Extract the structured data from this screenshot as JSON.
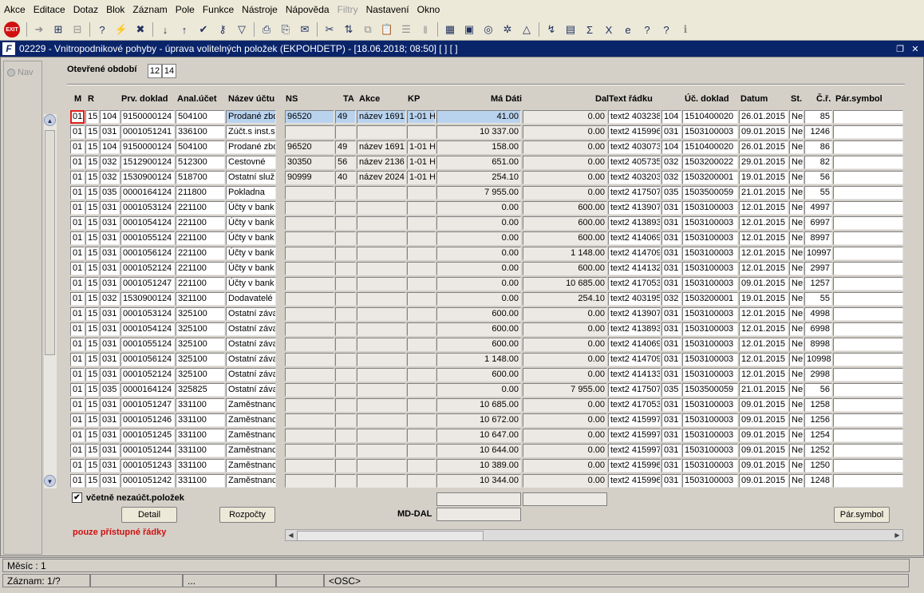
{
  "menu": [
    "Akce",
    "Editace",
    "Dotaz",
    "Blok",
    "Záznam",
    "Pole",
    "Funkce",
    "Nástroje",
    "Nápověda",
    "Filtry",
    "Nastavení",
    "Okno"
  ],
  "disabled_menu": "Filtry",
  "toolbar_icons": [
    "exit-icon",
    "sep",
    "arrow-icon",
    "insert-record-icon",
    "delete-record-icon",
    "sep",
    "query-icon",
    "query-run-icon",
    "cancel-query-icon",
    "sep",
    "sort-asc-icon",
    "sort-desc-icon",
    "check-icon",
    "key-icon",
    "filter-icon",
    "sep",
    "print-icon",
    "print-preview-icon",
    "mail-icon",
    "sep",
    "tools-icon",
    "split-icon",
    "copy-icon",
    "paste-icon",
    "list-icon",
    "columns-icon",
    "sep",
    "calc-icon",
    "save-icon",
    "globe-icon",
    "settings-icon",
    "triangle-icon",
    "sep",
    "chart-icon",
    "image-icon",
    "sum-icon",
    "excel-icon",
    "ie-icon",
    "help-context-icon",
    "help-icon",
    "info-icon"
  ],
  "window": {
    "title": "02229 - Vnitropodnikové pohyby - úprava volitelných položek (EKPOHDETP) - [18.06.2018; 08:50]  [ ]  [ ]"
  },
  "nav": {
    "label": "Nav"
  },
  "period": {
    "label": "Otevřené období",
    "from": "12",
    "to": "14"
  },
  "columns": [
    "M",
    "R",
    "",
    "Prv. doklad",
    "Anal.účet",
    "Název účtu",
    "NS",
    "TA",
    "Akce",
    "KP",
    "Má Dáti",
    "Dal",
    "Text řádku",
    "",
    "Úč. doklad",
    "Datum",
    "St.",
    "Č.ř.",
    "Pár.symbol"
  ],
  "rows": [
    [
      "01",
      "15",
      "104",
      "9150000124",
      "504100",
      "Prodané zbo",
      "96520",
      "49",
      "název 1691",
      "1-01 H",
      "41.00",
      "0.00",
      "text2 403238",
      "104",
      "1510400020",
      "26.01.2015",
      "Ne",
      "85",
      ""
    ],
    [
      "01",
      "15",
      "031",
      "0001051241",
      "336100",
      "Zúčt.s inst.s",
      "",
      "",
      "",
      "",
      "10 337.00",
      "0.00",
      "text2 415996",
      "031",
      "1503100003",
      "09.01.2015",
      "Ne",
      "1246",
      ""
    ],
    [
      "01",
      "15",
      "104",
      "9150000124",
      "504100",
      "Prodané zbo",
      "96520",
      "49",
      "název 1691",
      "1-01 H",
      "158.00",
      "0.00",
      "text2 403073",
      "104",
      "1510400020",
      "26.01.2015",
      "Ne",
      "86",
      ""
    ],
    [
      "01",
      "15",
      "032",
      "1512900124",
      "512300",
      "Cestovné",
      "30350",
      "56",
      "název 2136",
      "1-01 H",
      "651.00",
      "0.00",
      "text2 405735",
      "032",
      "1503200022",
      "29.01.2015",
      "Ne",
      "82",
      ""
    ],
    [
      "01",
      "15",
      "032",
      "1530900124",
      "518700",
      "Ostatní služ",
      "90999",
      "40",
      "název 2024",
      "1-01 H",
      "254.10",
      "0.00",
      "text2 403203",
      "032",
      "1503200001",
      "19.01.2015",
      "Ne",
      "56",
      ""
    ],
    [
      "01",
      "15",
      "035",
      "0000164124",
      "211800",
      "Pokladna",
      "",
      "",
      "",
      "",
      "7 955.00",
      "0.00",
      "text2 417507",
      "035",
      "1503500059",
      "21.01.2015",
      "Ne",
      "55",
      ""
    ],
    [
      "01",
      "15",
      "031",
      "0001053124",
      "221100",
      "Účty v bank",
      "",
      "",
      "",
      "",
      "0.00",
      "600.00",
      "text2 413907",
      "031",
      "1503100003",
      "12.01.2015",
      "Ne",
      "4997",
      ""
    ],
    [
      "01",
      "15",
      "031",
      "0001054124",
      "221100",
      "Účty v bank",
      "",
      "",
      "",
      "",
      "0.00",
      "600.00",
      "text2 413893",
      "031",
      "1503100003",
      "12.01.2015",
      "Ne",
      "6997",
      ""
    ],
    [
      "01",
      "15",
      "031",
      "0001055124",
      "221100",
      "Účty v bank",
      "",
      "",
      "",
      "",
      "0.00",
      "600.00",
      "text2 414069",
      "031",
      "1503100003",
      "12.01.2015",
      "Ne",
      "8997",
      ""
    ],
    [
      "01",
      "15",
      "031",
      "0001056124",
      "221100",
      "Účty v bank",
      "",
      "",
      "",
      "",
      "0.00",
      "1 148.00",
      "text2 414709",
      "031",
      "1503100003",
      "12.01.2015",
      "Ne",
      "10997",
      ""
    ],
    [
      "01",
      "15",
      "031",
      "0001052124",
      "221100",
      "Účty v bank",
      "",
      "",
      "",
      "",
      "0.00",
      "600.00",
      "text2 414132",
      "031",
      "1503100003",
      "12.01.2015",
      "Ne",
      "2997",
      ""
    ],
    [
      "01",
      "15",
      "031",
      "0001051247",
      "221100",
      "Účty v bank",
      "",
      "",
      "",
      "",
      "0.00",
      "10 685.00",
      "text2 417053",
      "031",
      "1503100003",
      "09.01.2015",
      "Ne",
      "1257",
      ""
    ],
    [
      "01",
      "15",
      "032",
      "1530900124",
      "321100",
      "Dodavatelé",
      "",
      "",
      "",
      "",
      "0.00",
      "254.10",
      "text2 403195",
      "032",
      "1503200001",
      "19.01.2015",
      "Ne",
      "55",
      ""
    ],
    [
      "01",
      "15",
      "031",
      "0001053124",
      "325100",
      "Ostatní záva",
      "",
      "",
      "",
      "",
      "600.00",
      "0.00",
      "text2 413907",
      "031",
      "1503100003",
      "12.01.2015",
      "Ne",
      "4998",
      ""
    ],
    [
      "01",
      "15",
      "031",
      "0001054124",
      "325100",
      "Ostatní záva",
      "",
      "",
      "",
      "",
      "600.00",
      "0.00",
      "text2 413893",
      "031",
      "1503100003",
      "12.01.2015",
      "Ne",
      "6998",
      ""
    ],
    [
      "01",
      "15",
      "031",
      "0001055124",
      "325100",
      "Ostatní záva",
      "",
      "",
      "",
      "",
      "600.00",
      "0.00",
      "text2 414069",
      "031",
      "1503100003",
      "12.01.2015",
      "Ne",
      "8998",
      ""
    ],
    [
      "01",
      "15",
      "031",
      "0001056124",
      "325100",
      "Ostatní záva",
      "",
      "",
      "",
      "",
      "1 148.00",
      "0.00",
      "text2 414709",
      "031",
      "1503100003",
      "12.01.2015",
      "Ne",
      "10998",
      ""
    ],
    [
      "01",
      "15",
      "031",
      "0001052124",
      "325100",
      "Ostatní záva",
      "",
      "",
      "",
      "",
      "600.00",
      "0.00",
      "text2 414133",
      "031",
      "1503100003",
      "12.01.2015",
      "Ne",
      "2998",
      ""
    ],
    [
      "01",
      "15",
      "035",
      "0000164124",
      "325825",
      "Ostatní záva",
      "",
      "",
      "",
      "",
      "0.00",
      "7 955.00",
      "text2 417507",
      "035",
      "1503500059",
      "21.01.2015",
      "Ne",
      "56",
      ""
    ],
    [
      "01",
      "15",
      "031",
      "0001051247",
      "331100",
      "Zaměstnanc",
      "",
      "",
      "",
      "",
      "10 685.00",
      "0.00",
      "text2 417053",
      "031",
      "1503100003",
      "09.01.2015",
      "Ne",
      "1258",
      ""
    ],
    [
      "01",
      "15",
      "031",
      "0001051246",
      "331100",
      "Zaměstnanc",
      "",
      "",
      "",
      "",
      "10 672.00",
      "0.00",
      "text2 415997",
      "031",
      "1503100003",
      "09.01.2015",
      "Ne",
      "1256",
      ""
    ],
    [
      "01",
      "15",
      "031",
      "0001051245",
      "331100",
      "Zaměstnanc",
      "",
      "",
      "",
      "",
      "10 647.00",
      "0.00",
      "text2 415997",
      "031",
      "1503100003",
      "09.01.2015",
      "Ne",
      "1254",
      ""
    ],
    [
      "01",
      "15",
      "031",
      "0001051244",
      "331100",
      "Zaměstnanc",
      "",
      "",
      "",
      "",
      "10 644.00",
      "0.00",
      "text2 415997",
      "031",
      "1503100003",
      "09.01.2015",
      "Ne",
      "1252",
      ""
    ],
    [
      "01",
      "15",
      "031",
      "0001051243",
      "331100",
      "Zaměstnanc",
      "",
      "",
      "",
      "",
      "10 389.00",
      "0.00",
      "text2 415996",
      "031",
      "1503100003",
      "09.01.2015",
      "Ne",
      "1250",
      ""
    ],
    [
      "01",
      "15",
      "031",
      "0001051242",
      "331100",
      "Zaměstnanc",
      "",
      "",
      "",
      "",
      "10 344.00",
      "0.00",
      "text2 415996",
      "031",
      "1503100003",
      "09.01.2015",
      "Ne",
      "1248",
      ""
    ]
  ],
  "include_unposted": {
    "label": "včetně nezaúčt.položek",
    "checked": true
  },
  "buttons": {
    "detail": "Detail",
    "budgets": "Rozpočty",
    "pair_symbol": "Pár.symbol"
  },
  "md_dal_label": "MD-DAL",
  "access_note": "pouze přístupné řádky",
  "status": {
    "line1": "Měsíc : 1",
    "record": "Záznam: 1/?",
    "seg2": "",
    "seg3": "...",
    "seg4": "",
    "osc": "<OSC>"
  },
  "colors": {
    "title_bar": "#0a246a",
    "selected_row": "#b9d3ee",
    "warning_text": "#d01010"
  }
}
